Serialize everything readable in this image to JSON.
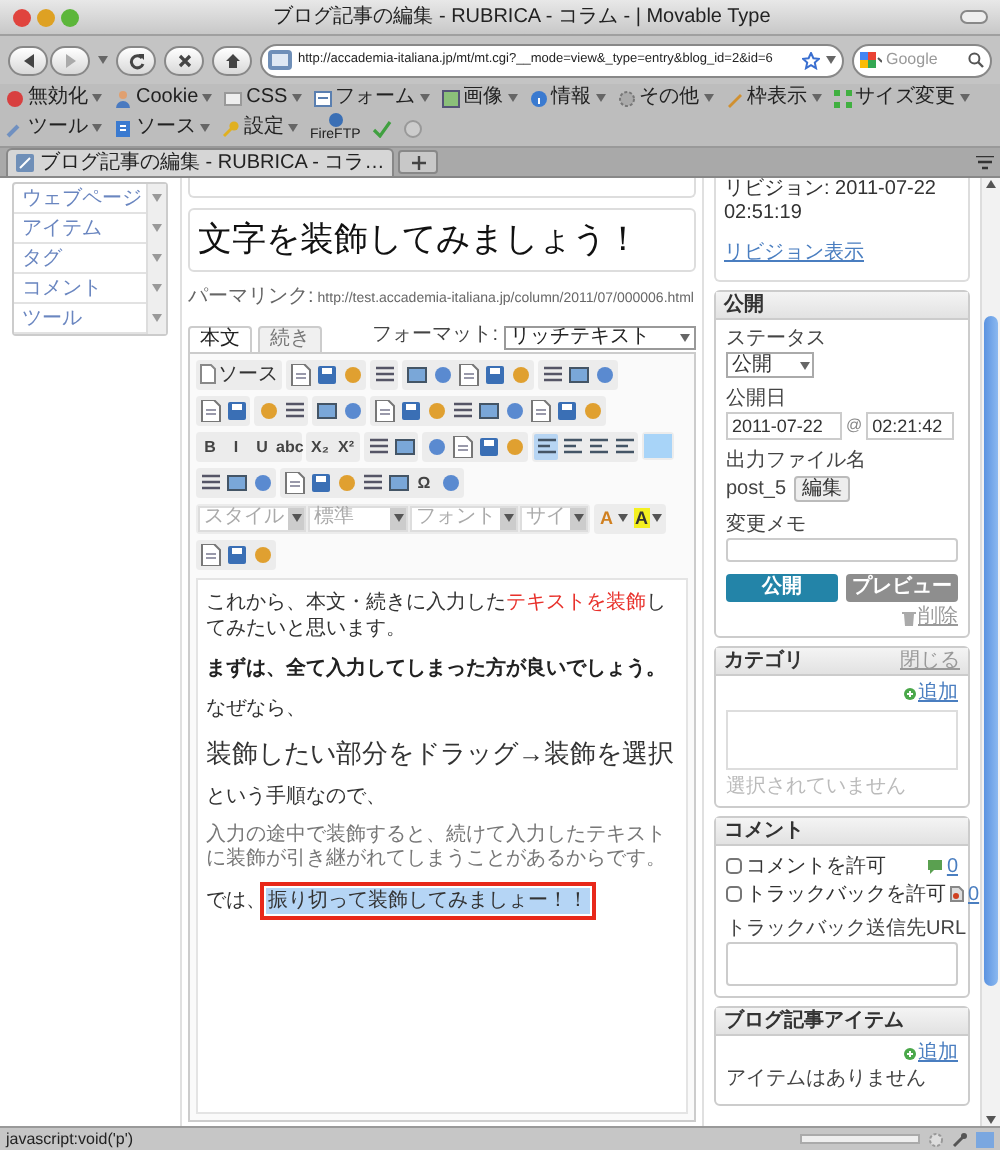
{
  "window": {
    "title": "ブログ記事の編集 - RUBRICA - コラム - | Movable Type"
  },
  "navigation": {
    "url": "http://accademia-italiana.jp/mt/mt.cgi?__mode=view&_type=entry&blog_id=2&id=6",
    "search_placeholder": "Google"
  },
  "bookmarks": [
    "無効化",
    "Cookie",
    "CSS",
    "フォーム",
    "画像",
    "情報",
    "その他",
    "枠表示",
    "サイズ変更",
    "ツール",
    "ソース",
    "設定"
  ],
  "fireftp": "FireFTP",
  "tabs": [
    {
      "label": "ブログ記事の編集 - RUBRICA - コラ…",
      "selected": true
    }
  ],
  "sidebar": {
    "items": [
      "ウェブページ",
      "アイテム",
      "タグ",
      "コメント",
      "ツール"
    ]
  },
  "entry": {
    "title": "文字を装飾してみましょう！",
    "permalink_label": "パーマリンク:",
    "permalink": "http://test.accademia-italiana.jp/column/2011/07/000006.html"
  },
  "editor": {
    "tabs": [
      {
        "label": "本文",
        "selected": true
      },
      {
        "label": "続き",
        "selected": false
      }
    ],
    "format_label": "フォーマット:",
    "format": "リッチテキスト",
    "toolbar": [
      [
        [
          {
            "kind": "source",
            "label": "ソース"
          }
        ],
        [
          {
            "kind": "icon"
          },
          {
            "kind": "icon"
          },
          {
            "kind": "icon"
          }
        ],
        [
          {
            "kind": "icon"
          }
        ],
        [
          {
            "kind": "icon"
          },
          {
            "kind": "icon"
          },
          {
            "kind": "icon"
          },
          {
            "kind": "icon"
          },
          {
            "kind": "icon"
          }
        ],
        [
          {
            "kind": "icon"
          },
          {
            "kind": "icon"
          },
          {
            "kind": "icon"
          }
        ]
      ],
      [
        [
          {
            "kind": "icon"
          },
          {
            "kind": "icon"
          }
        ],
        [
          {
            "kind": "icon"
          },
          {
            "kind": "icon"
          }
        ],
        [
          {
            "kind": "icon"
          },
          {
            "kind": "icon"
          }
        ],
        [
          {
            "kind": "icon"
          },
          {
            "kind": "icon"
          },
          {
            "kind": "icon"
          },
          {
            "kind": "icon"
          },
          {
            "kind": "icon"
          },
          {
            "kind": "icon"
          },
          {
            "kind": "icon"
          },
          {
            "kind": "icon"
          },
          {
            "kind": "icon"
          }
        ]
      ],
      [
        [
          {
            "kind": "text",
            "label": "B"
          },
          {
            "kind": "text",
            "label": "I"
          },
          {
            "kind": "text",
            "label": "U"
          },
          {
            "kind": "text",
            "label": "abc"
          }
        ],
        [
          {
            "kind": "text",
            "label": "X₂"
          },
          {
            "kind": "text",
            "label": "X²"
          }
        ],
        [
          {
            "kind": "icon"
          },
          {
            "kind": "icon"
          }
        ],
        [
          {
            "kind": "icon"
          },
          {
            "kind": "icon"
          },
          {
            "kind": "icon"
          },
          {
            "kind": "icon"
          }
        ],
        [
          {
            "kind": "icon",
            "selected": true
          },
          {
            "kind": "icon",
            "selected": false
          },
          {
            "kind": "icon",
            "selected": false
          },
          {
            "kind": "icon",
            "selected": false
          }
        ],
        [
          {
            "kind": "swatch"
          }
        ]
      ],
      [
        [
          {
            "kind": "icon"
          },
          {
            "kind": "icon"
          },
          {
            "kind": "icon"
          }
        ],
        [
          {
            "kind": "icon"
          },
          {
            "kind": "icon"
          },
          {
            "kind": "icon"
          },
          {
            "kind": "icon"
          },
          {
            "kind": "icon"
          },
          {
            "kind": "text",
            "label": "Ω"
          },
          {
            "kind": "icon"
          }
        ]
      ],
      [
        [
          {
            "kind": "select",
            "label": "スタイル"
          },
          {
            "kind": "select",
            "label": "標準"
          },
          {
            "kind": "select",
            "label": "フォント"
          },
          {
            "kind": "select",
            "label": "サイ"
          }
        ],
        [
          {
            "kind": "color",
            "label": "A"
          },
          {
            "kind": "color",
            "label": "A"
          }
        ]
      ],
      [
        [
          {
            "kind": "icon"
          },
          {
            "kind": "icon"
          },
          {
            "kind": "icon"
          }
        ]
      ]
    ],
    "content": [
      {
        "kind": "plain",
        "parts": [
          {
            "text": "これから、本文・続きに入力した",
            "red": false
          },
          {
            "text": "テキストを装飾",
            "red": true
          },
          {
            "text": "してみたいと思います。",
            "red": false
          }
        ]
      },
      {
        "kind": "bold",
        "text": "まずは、全て入力してしまった方が良いでしょう。"
      },
      {
        "kind": "plain",
        "parts": [
          {
            "text": "なぜなら、",
            "red": false
          }
        ]
      },
      {
        "kind": "heading",
        "text": "装飾したい部分をドラッグ→装飾を選択"
      },
      {
        "kind": "plain",
        "parts": [
          {
            "text": "という手順なので、",
            "red": false
          }
        ]
      },
      {
        "kind": "small",
        "text": "入力の途中で装飾すると、続けて入力したテキストに装飾が引き継がれてしまうことがあるからです。"
      },
      {
        "kind": "selection",
        "text": "では、",
        "selected_text": "振り切って装飾してみましょー！！"
      }
    ]
  },
  "revision": {
    "label": "リビジョン: 2011-07-22 02:51:19",
    "link": "リビジョン表示"
  },
  "publish": {
    "title": "公開",
    "status_label": "ステータス",
    "status": "公開",
    "date_label": "公開日",
    "date": "2011-07-22",
    "at": "@",
    "time": "02:21:42",
    "filename_label": "出力ファイル名",
    "filename": "post_5",
    "edit_button": "編集",
    "memo_label": "変更メモ",
    "publish_button": "公開",
    "preview_button": "プレビュー",
    "delete_link": "削除"
  },
  "categories": {
    "title": "カテゴリ",
    "close_link": "閉じる",
    "add_link": "追加",
    "empty": "選択されていません"
  },
  "comments": {
    "title": "コメント",
    "options": [
      {
        "label": "コメントを許可",
        "checked": false,
        "count": "0"
      },
      {
        "label": "トラックバックを許可",
        "checked": false,
        "count": "0"
      }
    ],
    "trackback_label": "トラックバック送信先URL"
  },
  "entry_items": {
    "title": "ブログ記事アイテム",
    "add_link": "追加",
    "empty": "アイテムはありません"
  },
  "status_bar": {
    "text": "javascript:void('p')"
  }
}
